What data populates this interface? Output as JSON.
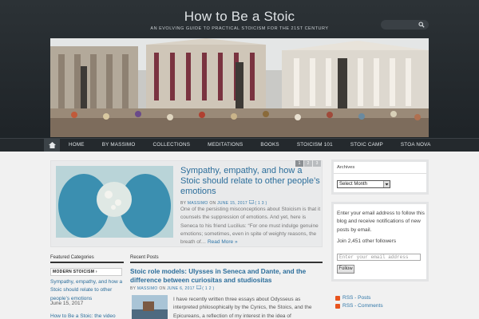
{
  "site": {
    "title": "How to Be a Stoic",
    "tagline": "AN EVOLVING GUIDE TO PRACTICAL STOICISM FOR THE 21ST CENTURY"
  },
  "nav": {
    "items": [
      "HOME",
      "BY MASSIMO",
      "COLLECTIONS",
      "MEDITATIONS",
      "BOOKS",
      "STOICISM 101",
      "STOIC CAMP",
      "STOA NOVA"
    ]
  },
  "featured": {
    "title": "Sympathy, empathy, and how a Stoic should relate to other people’s emotions",
    "meta_by": "BY",
    "meta_author": "MASSIMO",
    "meta_on": "ON",
    "meta_date": "JUNE 15, 2017",
    "meta_comments": "( 1 3 )",
    "excerpt": "One of the persisting misconceptions about Stoicism is that it counsels the suppression of emotions. And yet, here is Seneca to his friend Lucilius: “For one must indulge genuine emotions; sometimes, even in spite of weighty reasons, the breath of…",
    "more": "Read More »",
    "slides": [
      "1",
      "2",
      "3"
    ]
  },
  "archives": {
    "heading": "Archives",
    "select_value": "Select Month"
  },
  "subscribe": {
    "text": "Enter your email address to follow this blog and receive notifications of new posts by email.",
    "count": "Join 2,451 other followers",
    "placeholder": "Enter your email address",
    "button": "Follow"
  },
  "rss": {
    "posts": "RSS - Posts",
    "comments": "RSS - Comments"
  },
  "featured_categories": {
    "heading": "Featured Categories",
    "category": "MODERN STOICISM ›",
    "post_title": "Sympathy, empathy, and how a Stoic should relate to other people’s emotions",
    "post_date": "June 15, 2017",
    "post_title_2": "How to Be a Stoic: the video"
  },
  "recent_posts": {
    "heading": "Recent Posts",
    "title": "Stoic role models: Ulysses in Seneca and Dante, and the difference between curiositas and studiositas",
    "meta_by": "BY",
    "meta_author": "MASSIMO",
    "meta_on": "ON",
    "meta_date": "JUNE 6, 2017",
    "meta_comments": "( 1 2 )",
    "excerpt": "I have recently written three essays about Odysseus as interpreted philosophically by the Cynics, the Stoics, and the Epicureans, a reflection of my interest in the idea of"
  },
  "colors": {
    "header_bg": "#24292d",
    "link": "#2c6e9b",
    "rss": "#e8541e"
  }
}
